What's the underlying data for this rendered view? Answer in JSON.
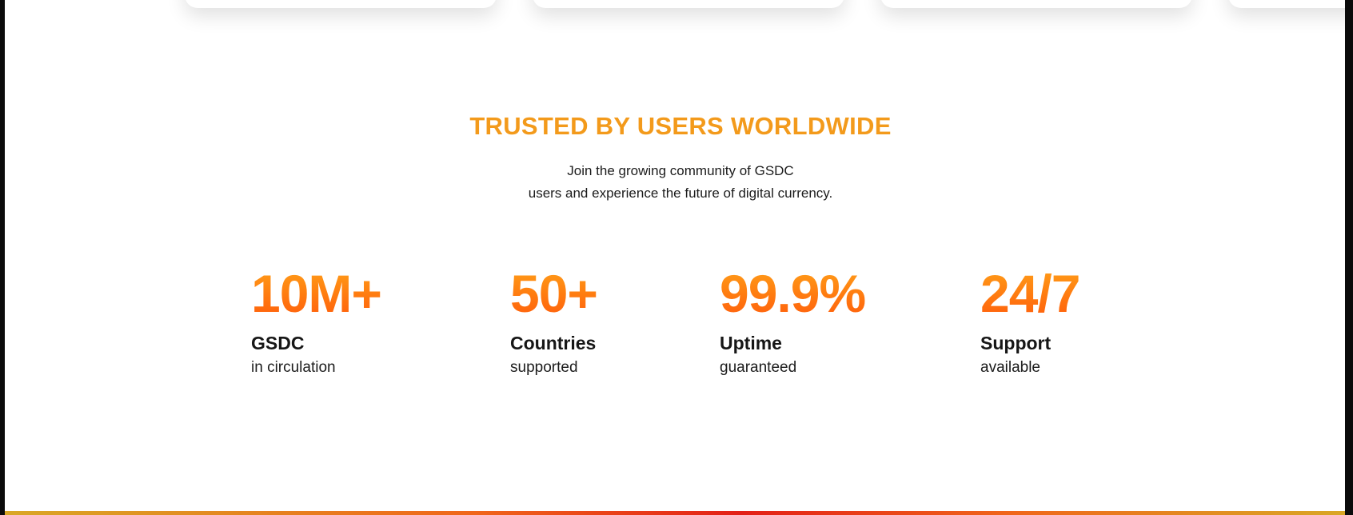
{
  "section": {
    "title": "TRUSTED BY USERS WORLDWIDE",
    "subtitle_line1": "Join the growing community of GSDC",
    "subtitle_line2": "users and experience the future of digital currency."
  },
  "stats": [
    {
      "value": "10M+",
      "label": "GSDC",
      "sub": "in circulation"
    },
    {
      "value": "50+",
      "label": "Countries",
      "sub": "supported"
    },
    {
      "value": "99.9%",
      "label": "Uptime",
      "sub": "guaranteed"
    },
    {
      "value": "24/7",
      "label": "Support",
      "sub": "available"
    }
  ],
  "colors": {
    "accent": "#f39a1b",
    "value_gradient_start": "#ffa21a",
    "value_gradient_end": "#ff5a0c",
    "text": "#161616",
    "bottom_bar": "#e32018"
  }
}
